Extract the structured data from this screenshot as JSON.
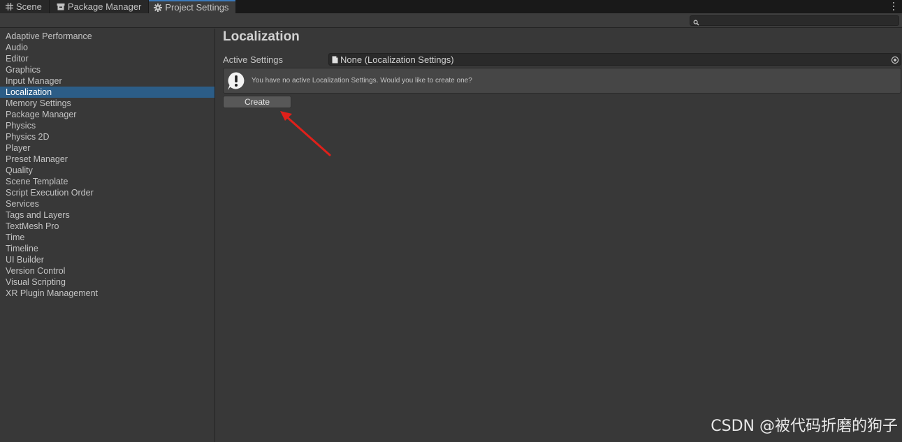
{
  "tabs": [
    {
      "label": "Scene",
      "icon": "grid-icon"
    },
    {
      "label": "Package Manager",
      "icon": "package-icon"
    },
    {
      "label": "Project Settings",
      "icon": "gear-icon",
      "active": true
    }
  ],
  "search": {
    "placeholder": ""
  },
  "sidebar": {
    "items": [
      "Adaptive Performance",
      "Audio",
      "Editor",
      "Graphics",
      "Input Manager",
      "Localization",
      "Memory Settings",
      "Package Manager",
      "Physics",
      "Physics 2D",
      "Player",
      "Preset Manager",
      "Quality",
      "Scene Template",
      "Script Execution Order",
      "Services",
      "Tags and Layers",
      "TextMesh Pro",
      "Time",
      "Timeline",
      "UI Builder",
      "Version Control",
      "Visual Scripting",
      "XR Plugin Management"
    ],
    "selected": "Localization"
  },
  "main": {
    "title": "Localization",
    "active_settings_label": "Active Settings",
    "active_settings_value": "None (Localization Settings)",
    "help_message": "You have no active Localization Settings. Would you like to create one?",
    "create_label": "Create"
  },
  "watermark": "CSDN @被代码折磨的狗子",
  "colors": {
    "selection": "#2c5d87",
    "annotation_arrow": "#e0201a"
  }
}
